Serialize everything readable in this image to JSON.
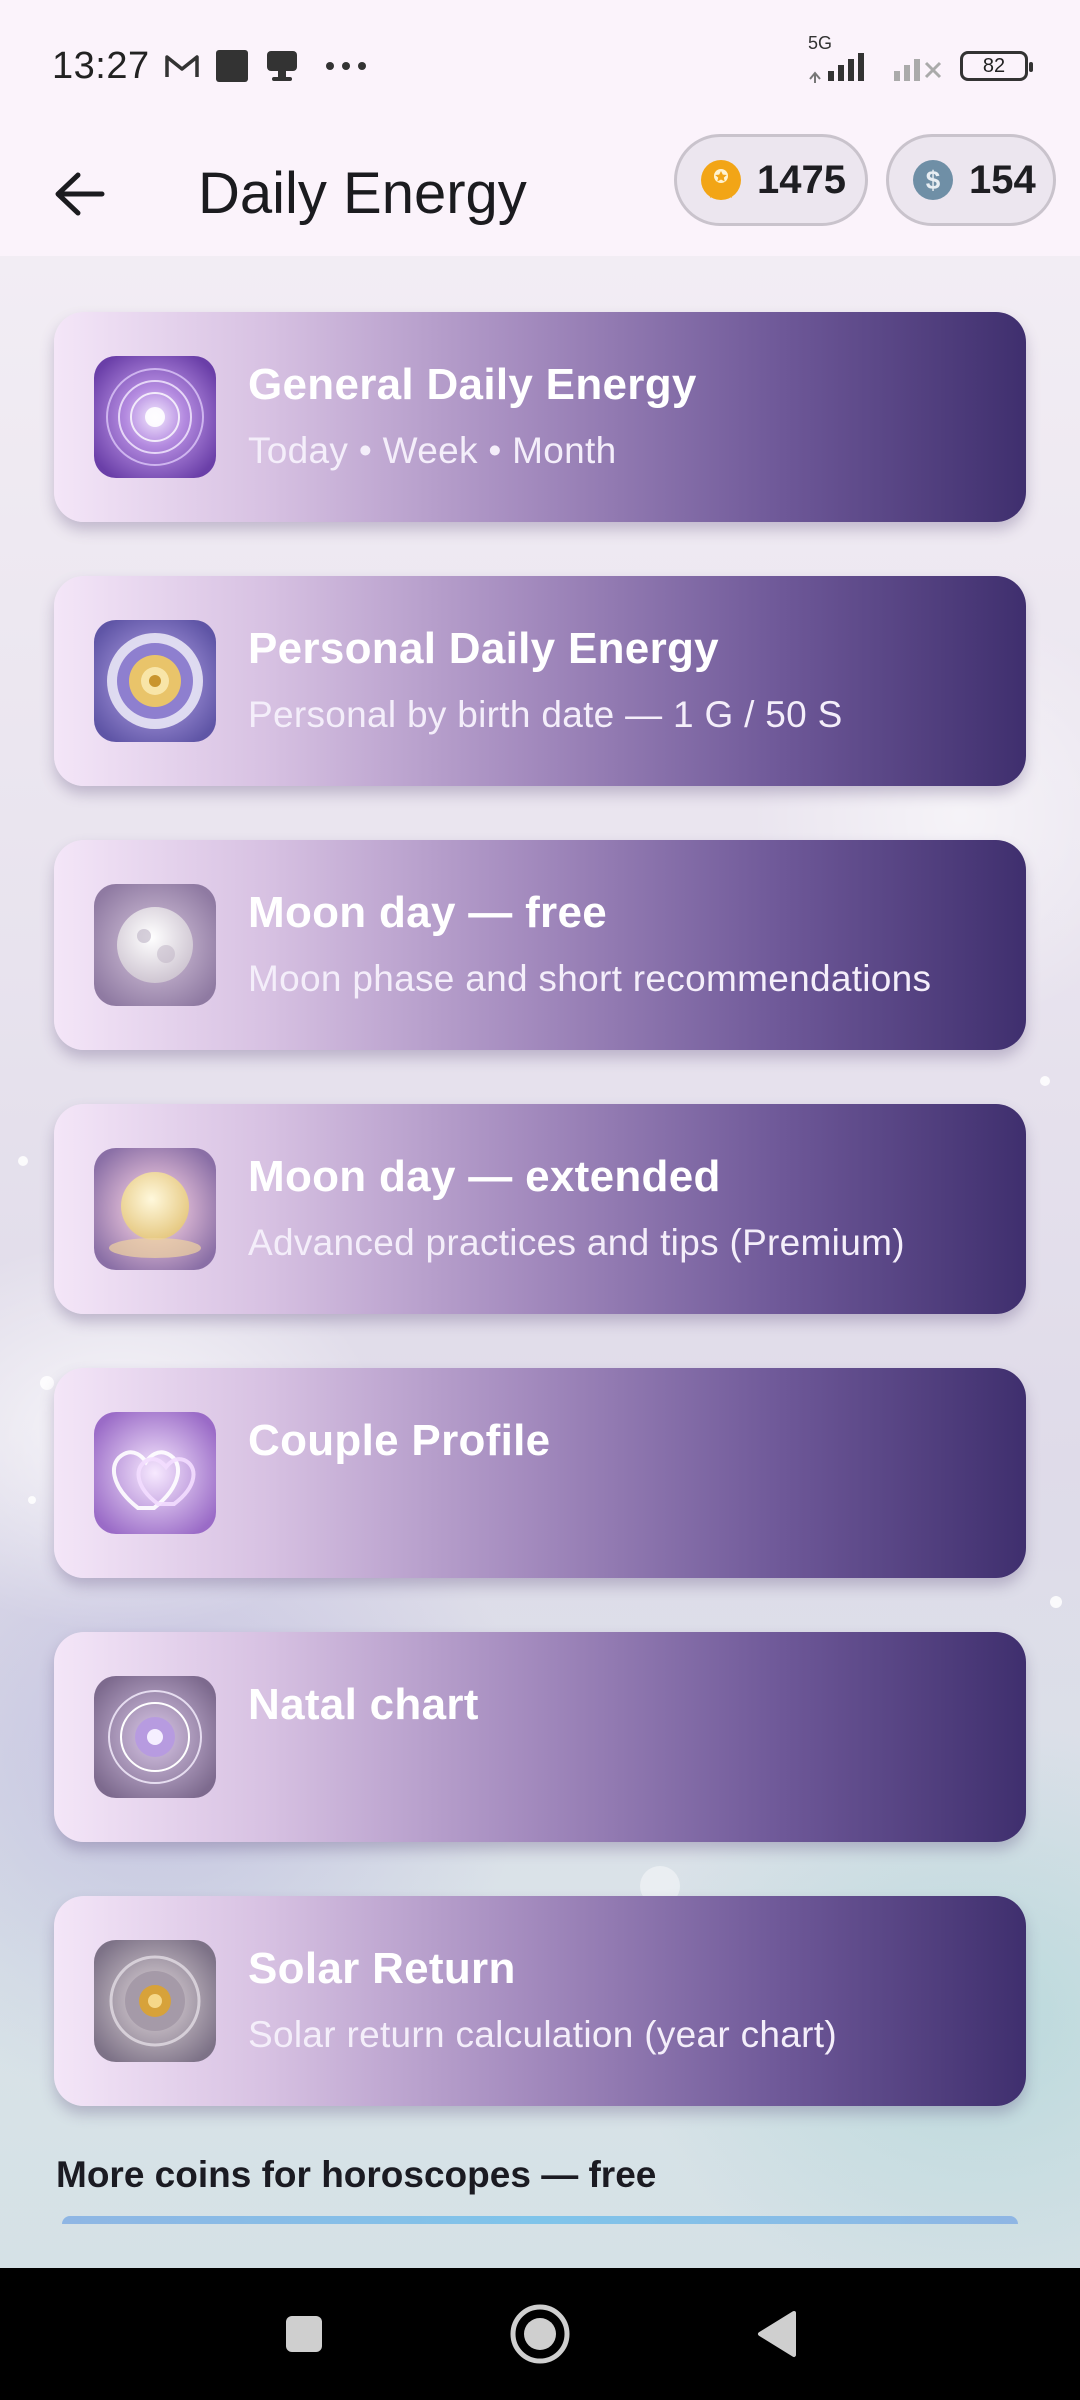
{
  "status_bar": {
    "time": "13:27",
    "icons": [
      "gmail-icon",
      "square-icon",
      "cast-icon",
      "more-dots-icon"
    ],
    "network": "5G",
    "battery": "82"
  },
  "app_bar": {
    "title": "Daily Energy",
    "points": "1475",
    "coins": "154"
  },
  "cards": [
    {
      "title": "General Daily Energy",
      "subtitle": "Today • Week • Month",
      "thumb": "mandala-thumb"
    },
    {
      "title": "Personal Daily Energy",
      "subtitle": "Personal by birth date — 1 G / 50 S",
      "thumb": "zodiac-wheel-thumb"
    },
    {
      "title": "Moon day — free",
      "subtitle": "Moon phase and short recommendations",
      "thumb": "full-moon-thumb"
    },
    {
      "title": "Moon day — extended",
      "subtitle": "Advanced practices and tips (Premium)",
      "thumb": "golden-moon-thumb"
    },
    {
      "title": "Couple Profile",
      "subtitle": "",
      "thumb": "hearts-thumb"
    },
    {
      "title": "Natal chart",
      "subtitle": "",
      "thumb": "natal-wheel-thumb"
    },
    {
      "title": "Solar Return",
      "subtitle": "Solar return calculation (year chart)",
      "thumb": "sun-wheel-thumb"
    }
  ],
  "section": {
    "label": "More coins for horoscopes — free"
  },
  "colors": {
    "card_start": "#f4e6f8",
    "card_end": "#3f2f6e",
    "points_icon": "#f2a516",
    "coins_icon": "#6f8fa6"
  }
}
